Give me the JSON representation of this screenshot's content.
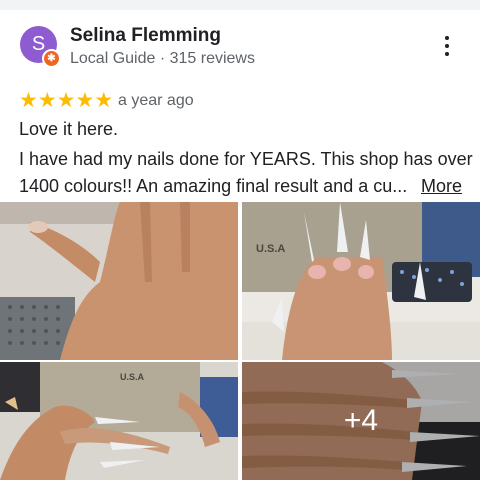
{
  "review": {
    "author_initial": "S",
    "author_name": "Selina Flemming",
    "author_meta": "Local Guide · 315 reviews",
    "badge_icon": "local-guide-badge-icon",
    "rating": 5,
    "rating_max": 5,
    "star_glyph": "★",
    "time_ago": "a year ago",
    "text_line1": "Love it here.",
    "text_line2": "I have had my nails done for YEARS. This shop has over",
    "text_line3": "1400 colours!! An amazing final result and a cu...",
    "more_label": "More",
    "menu_icon": "more-vert-icon"
  },
  "photos": {
    "extra_count_label": "+4"
  },
  "colors": {
    "avatar": "#8e5bd1",
    "badge": "#f16522",
    "star": "#fbbc04",
    "text": "#202124",
    "secondary_text": "#5f6368"
  }
}
